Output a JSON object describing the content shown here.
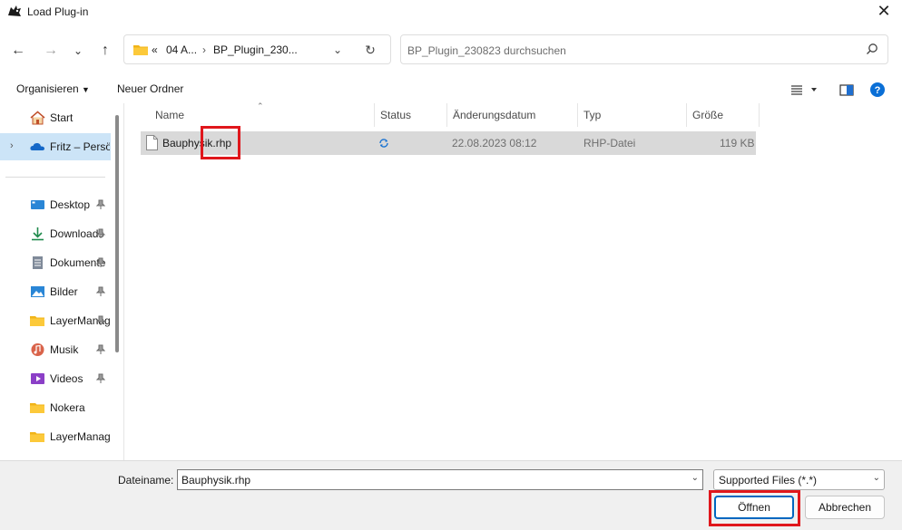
{
  "window": {
    "title": "Load Plug-in",
    "close_icon": "close-icon"
  },
  "nav": {
    "back_icon": "arrow-left-icon",
    "forward_icon": "arrow-right-icon",
    "recent_icon": "chevron-down-icon",
    "up_icon": "arrow-up-icon",
    "address": {
      "overflow": "«",
      "crumb1": "04 A...",
      "separator": "›",
      "crumb2": "BP_Plugin_230...",
      "dropdown_icon": "chevron-down-icon",
      "refresh_icon": "refresh-icon"
    },
    "search": {
      "placeholder": "BP_Plugin_230823 durchsuchen",
      "icon": "search-icon"
    }
  },
  "toolbar": {
    "organize": "Organisieren",
    "new_folder": "Neuer Ordner",
    "view_icon": "list-view-icon",
    "preview_icon": "preview-pane-icon",
    "help_icon": "help-icon"
  },
  "sidebar": {
    "items": [
      {
        "label": "Start",
        "icon": "home-icon"
      },
      {
        "label": "Fritz – Persönlich",
        "icon": "onedrive-cloud-icon"
      },
      {
        "label": "Desktop",
        "icon": "desktop-icon",
        "pinned": true
      },
      {
        "label": "Downloads",
        "icon": "download-icon",
        "pinned": true
      },
      {
        "label": "Dokumente",
        "icon": "document-icon",
        "pinned": true
      },
      {
        "label": "Bilder",
        "icon": "pictures-icon",
        "pinned": true
      },
      {
        "label": "LayerManager",
        "icon": "folder-icon",
        "pinned": true
      },
      {
        "label": "Musik",
        "icon": "music-icon",
        "pinned": true
      },
      {
        "label": "Videos",
        "icon": "video-icon",
        "pinned": true
      },
      {
        "label": "Nokera",
        "icon": "folder-icon"
      },
      {
        "label": "LayerManager",
        "icon": "folder-icon"
      }
    ]
  },
  "filelist": {
    "columns": [
      "Name",
      "Status",
      "Änderungsdatum",
      "Typ",
      "Größe"
    ],
    "rows": [
      {
        "name": "Bauphysik.rhp",
        "status_icon": "sync-icon",
        "modified": "22.08.2023 08:12",
        "type": "RHP-Datei",
        "size": "119 KB"
      }
    ]
  },
  "footer": {
    "filename_label": "Dateiname:",
    "filename_value": "Bauphysik.rhp",
    "filter_value": "Supported Files (*.*)",
    "open_label": "Öffnen",
    "cancel_label": "Abbrechen"
  },
  "colors": {
    "selection_row": "#d9d9d9",
    "nav_selected": "#cce4f7",
    "primary_border": "#0067c0",
    "annotation_red": "#e0171c",
    "help_blue": "#0a6fd6"
  }
}
